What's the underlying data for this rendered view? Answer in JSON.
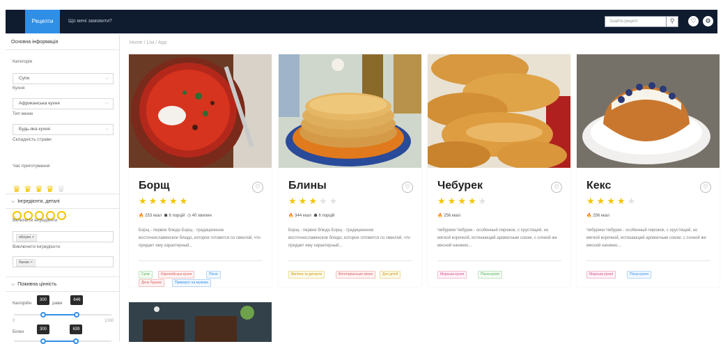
{
  "header": {
    "nav_recipes": "Рецепти",
    "nav_fridge": "Що мені замовити?",
    "search_placeholder": "Знайти рецепт"
  },
  "sidebar": {
    "main_info": "Основна інформація",
    "category_label": "Категорія",
    "category_value": "Супи",
    "cuisine_label": "Кухня",
    "cuisine_value": "Африканська кухня",
    "menu_type_label": "Тип меню",
    "menu_type_value": "Будь-яка кухня",
    "difficulty_label": "Складність страви",
    "difficulty_rating": 4,
    "difficulty_max": 5,
    "cook_time_label": "Час приготування",
    "ingredients_section": "Інгредієнти, деталі",
    "include_label": "Включити інгредієнти",
    "include_chip": "яблуко ×",
    "exclude_label": "Виключити інгредієнти",
    "exclude_chip": "банан ×",
    "nutrition_section": "Поживна цінність",
    "calories_label_a": "Калорійн",
    "calories_label_b": "рави",
    "calories_min": 300,
    "calories_max": 646,
    "calories_low_label": "0",
    "calories_high_label": "1000",
    "protein_label": "Білки",
    "protein_min": 300,
    "protein_max": 639
  },
  "breadcrumb": "Home / List / App",
  "cards": [
    {
      "title": "Борщ",
      "rating": 5,
      "kcal": "253 ккал",
      "portions": "6 порцій",
      "time": "40 хвилин",
      "desc": "Борщ - первое блюдо Борщ - традиционное восточнославянское блюдо, которое готовится со свеклой, что придает ему характерный...",
      "tags": [
        {
          "text": "Супи",
          "color": "green"
        },
        {
          "text": "Європейська кухня",
          "color": "red"
        },
        {
          "text": "Пісне",
          "color": "blue"
        },
        {
          "text": "День бурака",
          "color": "red"
        },
        {
          "text": "Приворот на мужика",
          "color": "blue"
        }
      ]
    },
    {
      "title": "Блины",
      "rating": 3,
      "kcal": "344 ккал",
      "portions": "6 порцій",
      "desc": "Борщ - первое блюдо Борщ - традиционное восточнославянское блюдо, которое готовится со свеклой, что придает ему характерный...",
      "tags": [
        {
          "text": "Випічка та десерти",
          "color": "yellow"
        },
        {
          "text": "Вегетаріанське меню",
          "color": "red"
        },
        {
          "text": "Для дітей",
          "color": "yellow"
        }
      ]
    },
    {
      "title": "Чебурек",
      "rating": 4,
      "kcal": "256 ккал",
      "desc": "Чебуреки Чебурек - особенный пирожок, с хрустящей, но мягкой корочкой, истекающий ароматным соком, с сочной же мясной начинко...",
      "tags": [
        {
          "text": "Морська кухня",
          "color": "pink"
        },
        {
          "text": "Пісна кухня",
          "color": "green"
        }
      ]
    },
    {
      "title": "Кекс",
      "rating": 4,
      "kcal": "256 ккал",
      "desc": "Чебуреки Чебурек - особенный пирожок, с хрустящей, но мягкой корочкой, истекающий ароматным соком, с сочной же мясной начинко...",
      "tags": [
        {
          "text": "Морська кухня",
          "color": "pink"
        },
        {
          "text": "Пісна кухня",
          "color": "blue"
        }
      ]
    }
  ],
  "colors": {
    "topbar": "#0f1b2e",
    "accent": "#2f8fe6",
    "star": "#f2c500"
  }
}
